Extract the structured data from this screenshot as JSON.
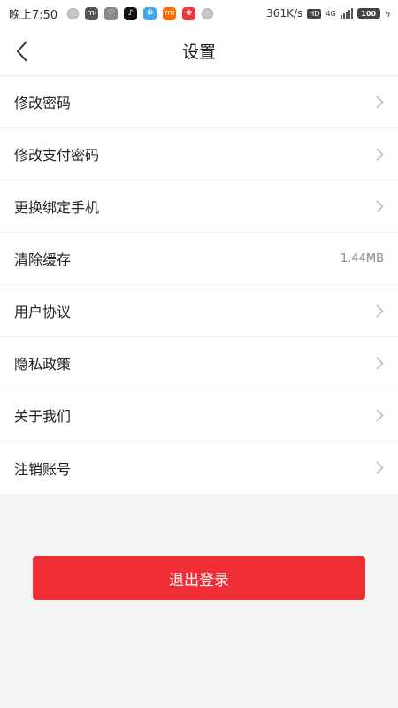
{
  "status_bar": {
    "time": "晚上7:50",
    "network_speed": "361K/s",
    "hd": "HD",
    "network_type": "4G",
    "battery": "100",
    "apps": [
      {
        "name": "status-app-icon",
        "color": "#c0c0c0",
        "glyph": ""
      },
      {
        "name": "mi-app-icon",
        "color": "#555555",
        "glyph": "mi"
      },
      {
        "name": "heart-app-icon",
        "color": "#888888",
        "glyph": "♡"
      },
      {
        "name": "tiktok-icon",
        "color": "#111111",
        "glyph": "♪"
      },
      {
        "name": "pinwheel-icon",
        "color": "#3fa7f0",
        "glyph": "✻"
      },
      {
        "name": "xiaomi-icon",
        "color": "#ff6a00",
        "glyph": "mi"
      },
      {
        "name": "flower-app-icon",
        "color": "#e8363f",
        "glyph": "❀"
      }
    ]
  },
  "nav": {
    "title": "设置",
    "back_icon": "chevron-left-icon"
  },
  "settings": {
    "items": [
      {
        "label": "修改密码",
        "value": "",
        "chevron": true
      },
      {
        "label": "修改支付密码",
        "value": "",
        "chevron": true
      },
      {
        "label": "更换绑定手机",
        "value": "",
        "chevron": true
      },
      {
        "label": "清除缓存",
        "value": "1.44MB",
        "chevron": false
      },
      {
        "label": "用户协议",
        "value": "",
        "chevron": true
      },
      {
        "label": "隐私政策",
        "value": "",
        "chevron": true
      },
      {
        "label": "关于我们",
        "value": "",
        "chevron": true
      },
      {
        "label": "注销账号",
        "value": "",
        "chevron": true
      }
    ]
  },
  "logout": {
    "label": "退出登录"
  },
  "colors": {
    "accent": "#ee2d34",
    "background": "#f4f4f4"
  }
}
